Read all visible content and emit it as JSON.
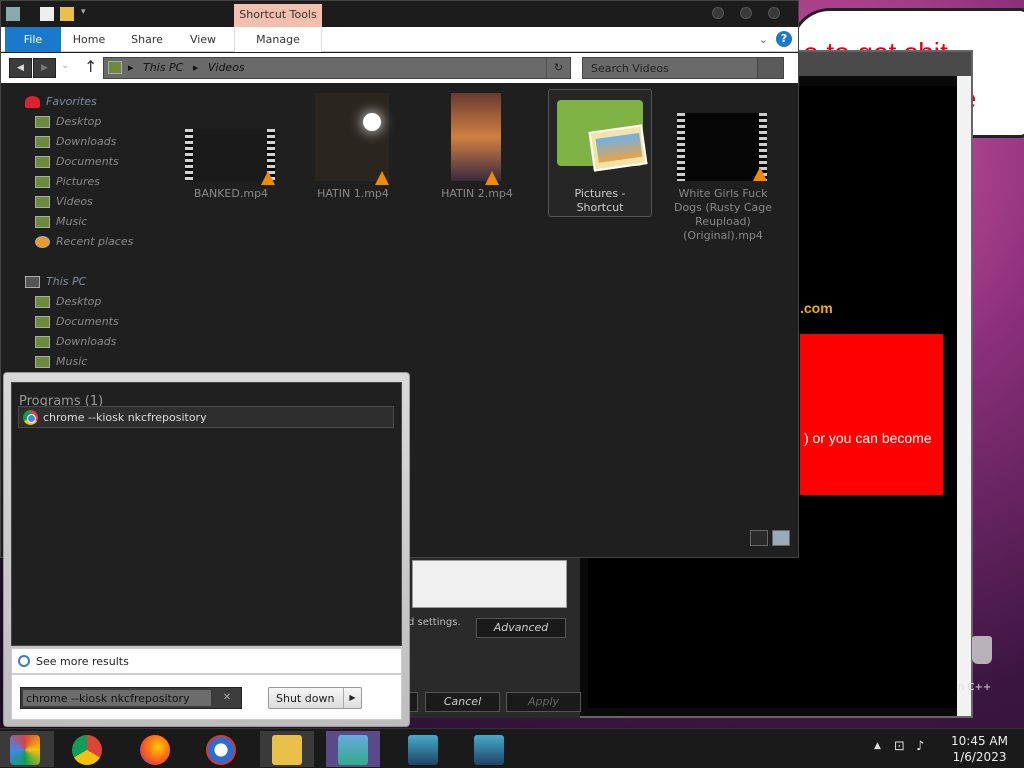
{
  "background": {
    "speech_text_1": "e to get shit",
    "speech_text_2": "te",
    "dotcom": ".com",
    "red_box_text": ") or you can become",
    "cpp_text": "n C++"
  },
  "dialog": {
    "settings_text": "d settings.",
    "advanced_label": "Advanced",
    "cancel_label": "Cancel",
    "apply_label": "Apply"
  },
  "explorer": {
    "shortcut_tools_label": "Shortcut Tools",
    "ribbon_tabs": [
      "File",
      "Home",
      "Share",
      "View",
      "Manage"
    ],
    "address": {
      "segments": [
        "This PC",
        "Videos"
      ]
    },
    "search_placeholder": "Search Videos",
    "nav": {
      "favorites_label": "Favorites",
      "favorites": [
        "Desktop",
        "Downloads",
        "Documents",
        "Pictures",
        "Videos",
        "Music",
        "Recent places"
      ],
      "thispc_label": "This PC",
      "thispc": [
        "Desktop",
        "Documents",
        "Downloads",
        "Music"
      ]
    },
    "files": [
      {
        "name": "BANKED.mp4",
        "type": "video"
      },
      {
        "name": "HATIN 1.mp4",
        "type": "video"
      },
      {
        "name": "HATIN 2.mp4",
        "type": "video"
      },
      {
        "name": "Pictures - Shortcut",
        "type": "folder-shortcut"
      },
      {
        "name": "White Girls Fuck Dogs (Rusty Cage Reupload) (Original).mp4",
        "type": "video"
      }
    ]
  },
  "start_menu": {
    "programs_header": "Programs (1)",
    "program_item": "chrome --kiosk nkcfrepository",
    "see_more": "See more results",
    "search_value": "chrome --kiosk nkcfrepository",
    "clear_glyph": "✕",
    "shutdown_label": "Shut down"
  },
  "taskbar": {
    "time": "10:45 AM",
    "date": "1/6/2023"
  },
  "colors": {
    "file_tab": "#1979ca",
    "shortcut_tools": "#f4c0ad",
    "red_box": "#ff0000",
    "vlc_orange": "#f08a00"
  }
}
